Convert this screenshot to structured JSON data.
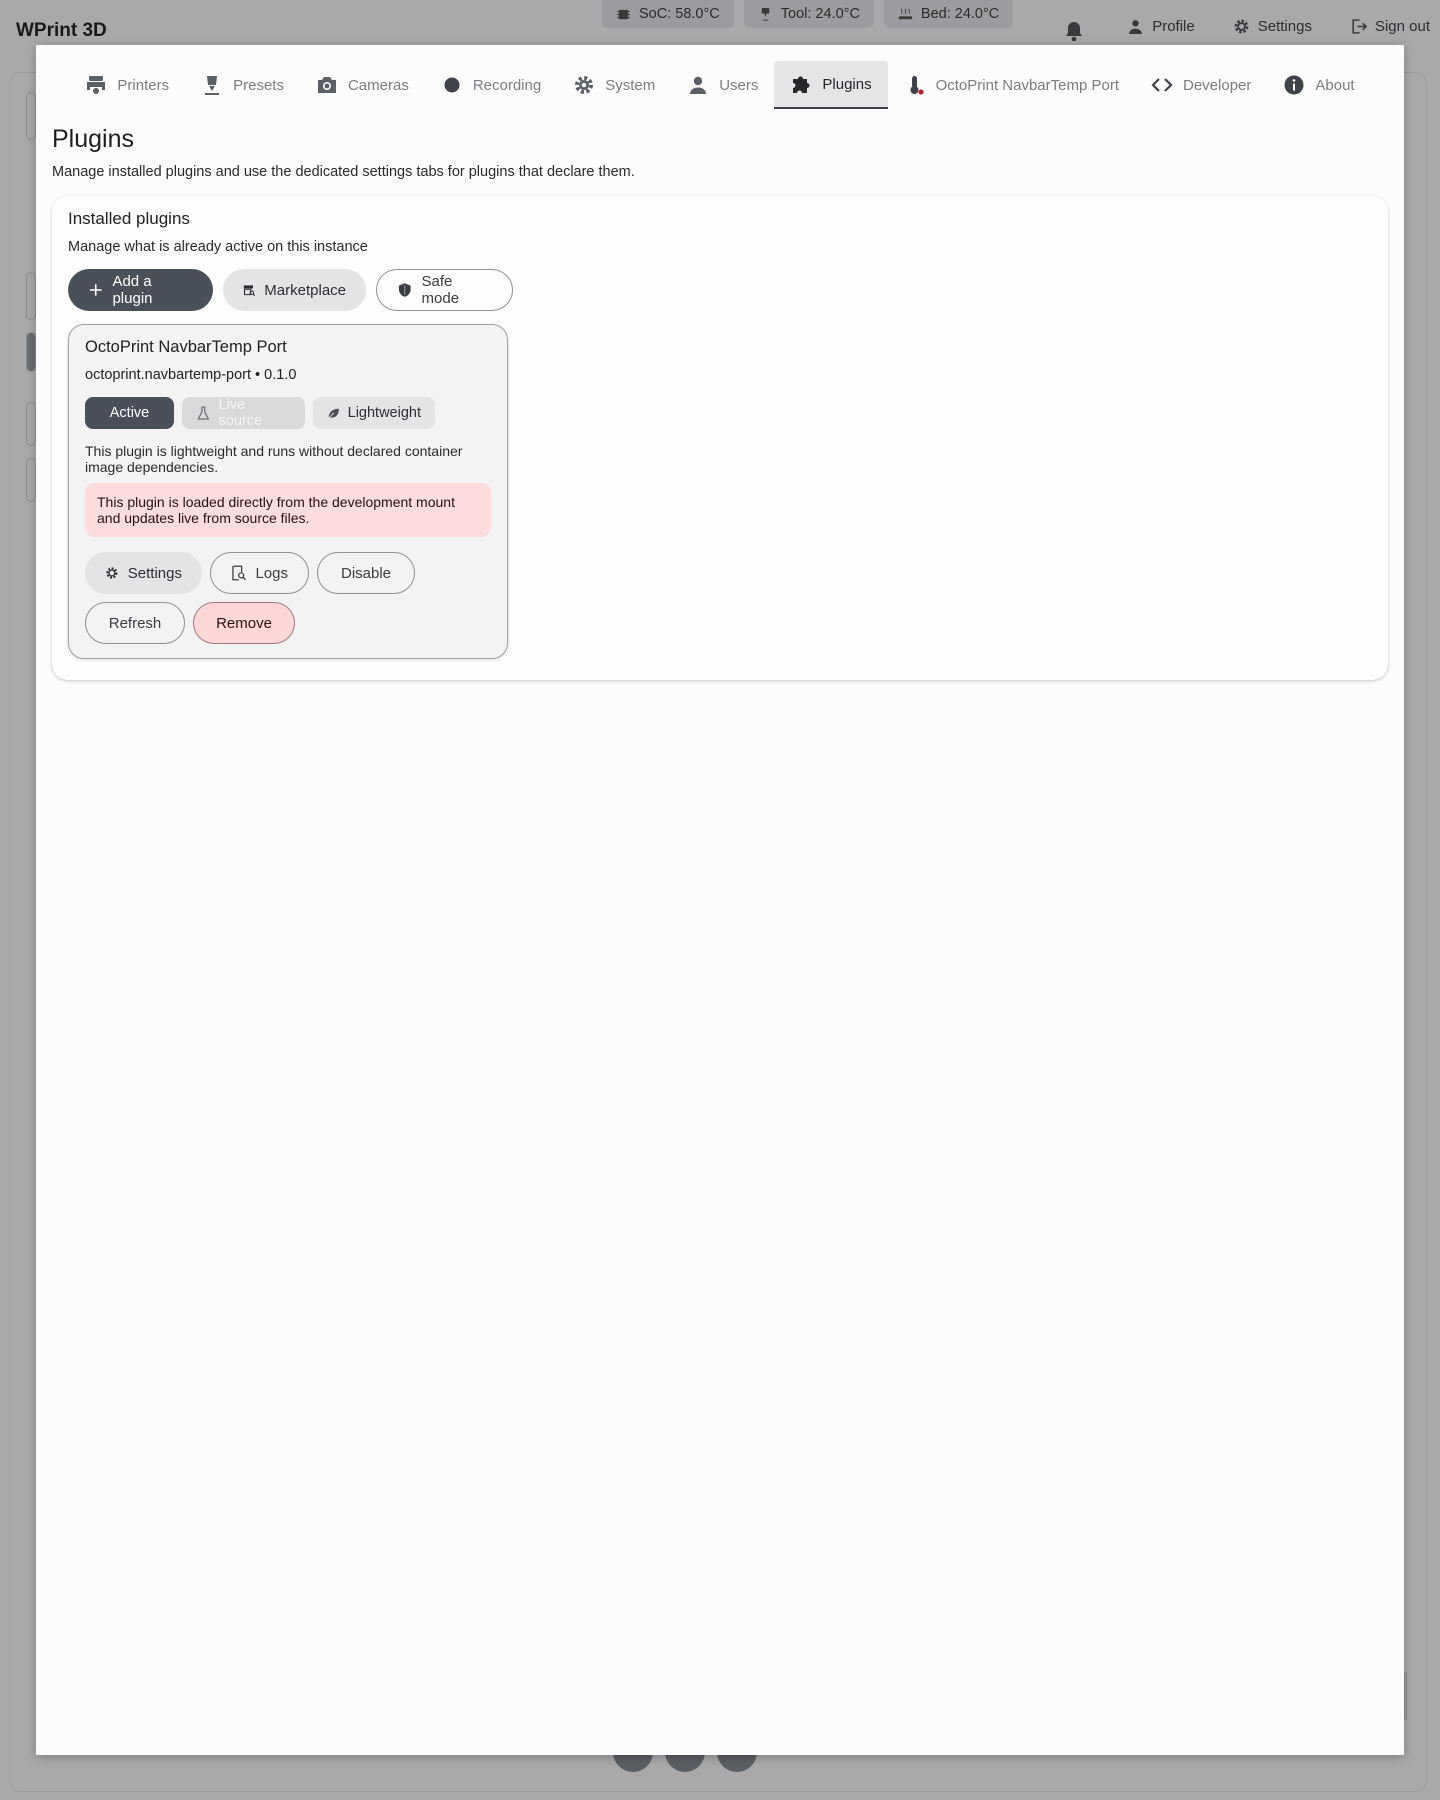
{
  "app": {
    "title": "WPrint 3D"
  },
  "status_chips": [
    {
      "icon": "chip-icon",
      "label": "SoC: 58.0°C"
    },
    {
      "icon": "nozzle-icon",
      "label": "Tool: 24.0°C"
    },
    {
      "icon": "heated-bed-icon",
      "label": "Bed: 24.0°C"
    }
  ],
  "top_actions": {
    "profile": "Profile",
    "settings": "Settings",
    "sign_out": "Sign out"
  },
  "tabs": [
    {
      "label": "Printers",
      "icon": "printer-icon"
    },
    {
      "label": "Presets",
      "icon": "extruder-icon"
    },
    {
      "label": "Cameras",
      "icon": "camera-icon"
    },
    {
      "label": "Recording",
      "icon": "record-dot-icon"
    },
    {
      "label": "System",
      "icon": "gear-icon"
    },
    {
      "label": "Users",
      "icon": "user-icon"
    },
    {
      "label": "Plugins",
      "icon": "puzzle-icon",
      "active": true
    },
    {
      "label": "OctoPrint NavbarTemp Port",
      "icon": "thermometer-icon"
    },
    {
      "label": "Developer",
      "icon": "code-icon"
    },
    {
      "label": "About",
      "icon": "info-icon"
    }
  ],
  "page": {
    "title": "Plugins",
    "subtitle": "Manage installed plugins and use the dedicated settings tabs for plugins that declare them."
  },
  "installed": {
    "title": "Installed plugins",
    "subtitle": "Manage what is already active on this instance",
    "add_label": "Add a plugin",
    "marketplace_label": "Marketplace",
    "safe_mode_label": "Safe mode"
  },
  "plugin": {
    "name": "OctoPrint NavbarTemp Port",
    "id_version": "octoprint.navbartemp-port • 0.1.0",
    "tags": {
      "active": "Active",
      "live_source": "Live source",
      "lightweight": "Lightweight"
    },
    "description": "This plugin is lightweight and runs without declared container image dependencies.",
    "dev_note": "This plugin is loaded directly from the development mount and updates live from source files.",
    "actions": {
      "settings": "Settings",
      "logs": "Logs",
      "disable": "Disable",
      "refresh": "Refresh",
      "remove": "Remove"
    }
  },
  "colors": {
    "primary_dark": "#4a505a",
    "danger_bg": "#fdd6d6",
    "note_bg": "#fedbdd",
    "overlay": "#a9a9ab"
  }
}
